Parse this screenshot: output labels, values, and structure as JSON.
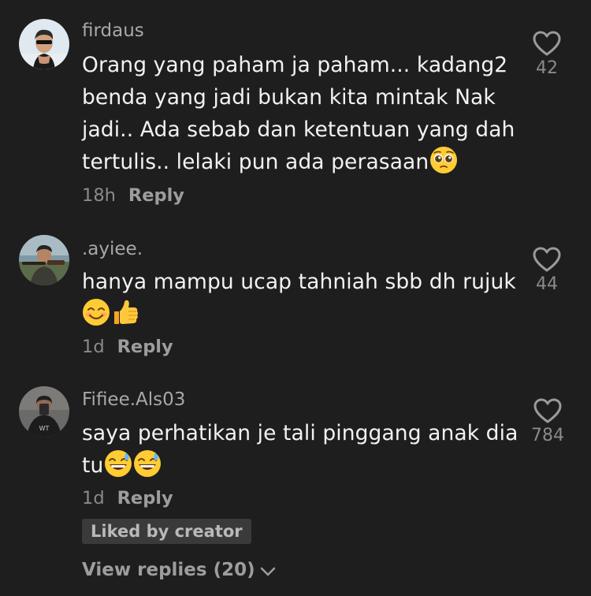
{
  "comments": [
    {
      "username": "firdaus",
      "lines": [
        "Orang yang paham ja paham... kadang2",
        "benda yang jadi bukan kita mintak Nak",
        "jadi.. Ada sebab dan ketentuan yang dah",
        "tertulis.. lelaki pun ada perasaan"
      ],
      "time": "18h",
      "reply_label": "Reply",
      "likes": "42",
      "emojis": [
        "pleading-face"
      ]
    },
    {
      "username": ".ayiee.",
      "lines": [
        "hanya mampu ucap tahniah sbb dh rujuk"
      ],
      "time": "1d",
      "reply_label": "Reply",
      "likes": "44",
      "emojis": [
        "smiling-face",
        "thumbs-up"
      ]
    },
    {
      "username": "Fifiee.Als03",
      "lines": [
        "saya perhatikan je tali pinggang anak dia",
        "tu"
      ],
      "time": "1d",
      "reply_label": "Reply",
      "likes": "784",
      "emojis": [
        "grinning-sweat-face",
        "grinning-sweat-face"
      ]
    }
  ],
  "creator_badge": "Liked by creator",
  "view_replies": "View replies (20)",
  "colors": {
    "background": "#1e1e1e",
    "username": "#a8a8a8",
    "body_text": "#f2f2f2",
    "muted": "#8a8a8a",
    "badge_bg": "#3a3a3a"
  },
  "icons": [
    "heart-outline-icon",
    "chevron-down-icon"
  ]
}
